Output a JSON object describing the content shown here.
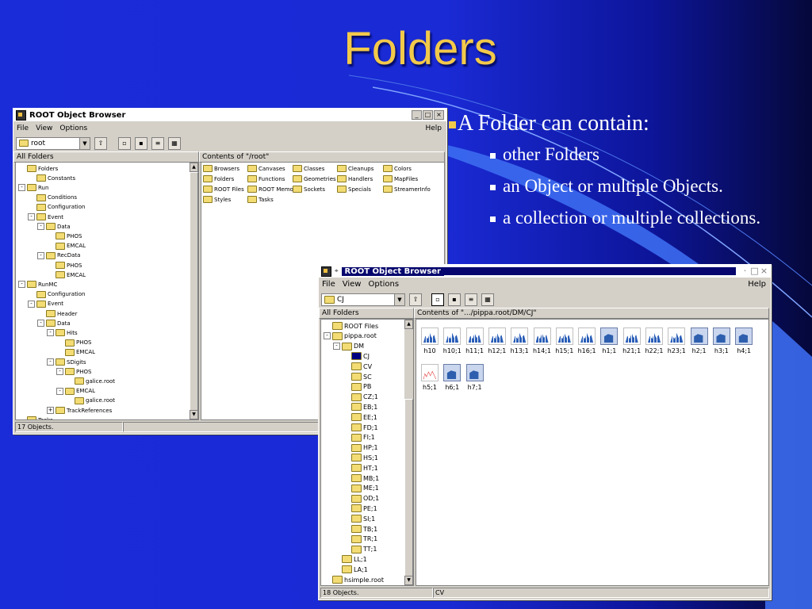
{
  "slide": {
    "title": "Folders",
    "bullet_main": "A Folder can contain:",
    "sub_bullets": [
      "other Folders",
      "an Object or multiple Objects.",
      "a collection or multiple collections."
    ]
  },
  "colors": {
    "title": "#f3c94a",
    "background": "#1a2bd8",
    "selection": "#000080"
  },
  "window1": {
    "title": "ROOT Object Browser",
    "menu": [
      "File",
      "View",
      "Options"
    ],
    "help": "Help",
    "combo_value": "root",
    "left_header": "All Folders",
    "right_header": "Contents of \"/root\"",
    "tree": [
      {
        "label": "Folders",
        "toggle": ""
      },
      {
        "label": "Constants",
        "toggle": ""
      },
      {
        "label": "Run",
        "toggle": "-"
      },
      {
        "label": "Conditions",
        "toggle": ""
      },
      {
        "label": "Configuration",
        "toggle": ""
      },
      {
        "label": "Event",
        "toggle": "-"
      },
      {
        "label": "Data",
        "toggle": "-"
      },
      {
        "label": "PHOS",
        "toggle": ""
      },
      {
        "label": "EMCAL",
        "toggle": ""
      },
      {
        "label": "RecData",
        "toggle": "-"
      },
      {
        "label": "PHOS",
        "toggle": ""
      },
      {
        "label": "EMCAL",
        "toggle": ""
      },
      {
        "label": "RunMC",
        "toggle": "-"
      },
      {
        "label": "Configuration",
        "toggle": ""
      },
      {
        "label": "Event",
        "toggle": "-"
      },
      {
        "label": "Header",
        "toggle": ""
      },
      {
        "label": "Data",
        "toggle": "-"
      },
      {
        "label": "Hits",
        "toggle": "-"
      },
      {
        "label": "PHOS",
        "toggle": ""
      },
      {
        "label": "EMCAL",
        "toggle": ""
      },
      {
        "label": "SDigits",
        "toggle": "-"
      },
      {
        "label": "PHOS",
        "toggle": "-"
      },
      {
        "label": "galice.root",
        "toggle": ""
      },
      {
        "label": "EMCAL",
        "toggle": "-"
      },
      {
        "label": "galice.root",
        "toggle": ""
      },
      {
        "label": "TrackReferences",
        "toggle": "+"
      },
      {
        "label": "Tasks",
        "toggle": ""
      }
    ],
    "contents": [
      "Browsers",
      "Canvases",
      "Classes",
      "Cleanups",
      "Colors",
      "Folders",
      "Functions",
      "Geometries",
      "Handlers",
      "MapFiles",
      "ROOT Files",
      "ROOT Memory",
      "Sockets",
      "Specials",
      "StreamerInfo",
      "Styles",
      "Tasks"
    ],
    "status": "17 Objects."
  },
  "window2": {
    "title": "ROOT Object Browser",
    "menu": [
      "File",
      "View",
      "Options"
    ],
    "help": "Help",
    "combo_value": "CJ",
    "left_header": "All Folders",
    "right_header": "Contents of \".../pippa.root/DM/CJ\"",
    "tree": [
      {
        "label": "ROOT Files",
        "toggle": ""
      },
      {
        "label": "pippa.root",
        "toggle": "-"
      },
      {
        "label": "DM",
        "toggle": "-"
      },
      {
        "label": "CJ",
        "toggle": "",
        "selected": true
      },
      {
        "label": "CV",
        "toggle": ""
      },
      {
        "label": "SC",
        "toggle": ""
      },
      {
        "label": "PB",
        "toggle": ""
      },
      {
        "label": "CZ;1",
        "toggle": ""
      },
      {
        "label": "EB;1",
        "toggle": ""
      },
      {
        "label": "EE;1",
        "toggle": ""
      },
      {
        "label": "FD;1",
        "toggle": ""
      },
      {
        "label": "FI;1",
        "toggle": ""
      },
      {
        "label": "HP;1",
        "toggle": ""
      },
      {
        "label": "HS;1",
        "toggle": ""
      },
      {
        "label": "HT;1",
        "toggle": ""
      },
      {
        "label": "MB;1",
        "toggle": ""
      },
      {
        "label": "ME;1",
        "toggle": ""
      },
      {
        "label": "OD;1",
        "toggle": ""
      },
      {
        "label": "PE;1",
        "toggle": ""
      },
      {
        "label": "SI;1",
        "toggle": ""
      },
      {
        "label": "TB;1",
        "toggle": ""
      },
      {
        "label": "TR;1",
        "toggle": ""
      },
      {
        "label": "TT;1",
        "toggle": ""
      },
      {
        "label": "LL;1",
        "toggle": ""
      },
      {
        "label": "LA;1",
        "toggle": ""
      },
      {
        "label": "hsimple.root",
        "toggle": ""
      }
    ],
    "histograms": [
      {
        "label": "h10",
        "icon": "histogram-icon"
      },
      {
        "label": "h10;1",
        "icon": "histogram-icon"
      },
      {
        "label": "h11;1",
        "icon": "histogram-icon"
      },
      {
        "label": "h12;1",
        "icon": "histogram-icon"
      },
      {
        "label": "h13;1",
        "icon": "histogram-icon"
      },
      {
        "label": "h14;1",
        "icon": "histogram-icon"
      },
      {
        "label": "h15;1",
        "icon": "histogram-icon"
      },
      {
        "label": "h16;1",
        "icon": "histogram-icon"
      },
      {
        "label": "h1;1",
        "icon": "key-icon"
      },
      {
        "label": "h21;1",
        "icon": "histogram-icon"
      },
      {
        "label": "h22;1",
        "icon": "histogram-icon"
      },
      {
        "label": "h23;1",
        "icon": "histogram-icon"
      },
      {
        "label": "h2;1",
        "icon": "key-icon"
      },
      {
        "label": "h3;1",
        "icon": "key-icon"
      },
      {
        "label": "h4;1",
        "icon": "key-icon"
      },
      {
        "label": "h5;1",
        "icon": "graph-icon"
      },
      {
        "label": "h6;1",
        "icon": "key-icon"
      },
      {
        "label": "h7;1",
        "icon": "key-icon"
      }
    ],
    "status": "18 Objects.",
    "status_right": "CV"
  }
}
